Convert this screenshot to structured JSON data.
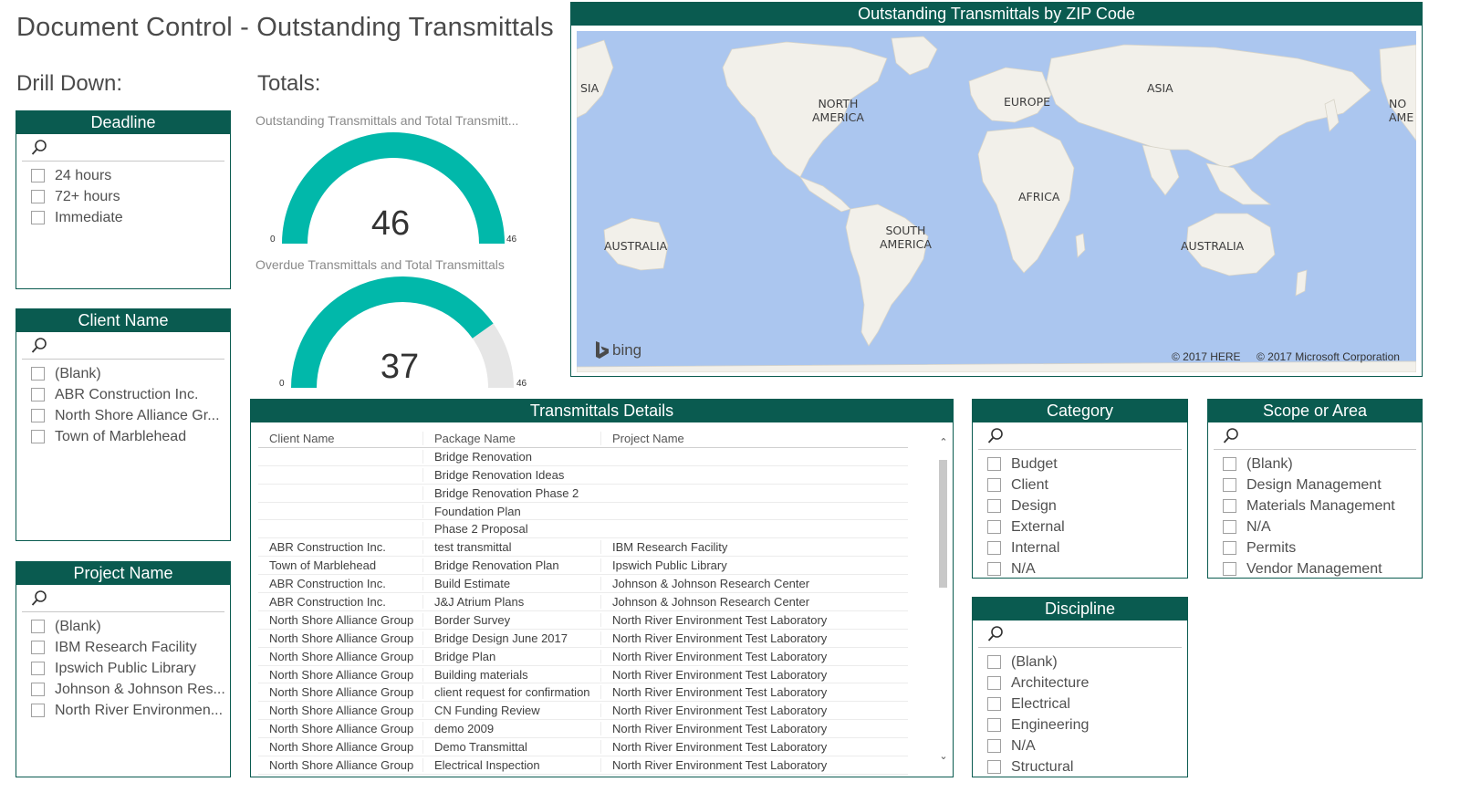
{
  "page_title": "Document Control - Outstanding Transmittals",
  "drill_down_label": "Drill Down:",
  "totals_label": "Totals:",
  "deadline": {
    "title": "Deadline",
    "items": [
      "24 hours",
      "72+ hours",
      "Immediate"
    ]
  },
  "client_name": {
    "title": "Client Name",
    "items": [
      "(Blank)",
      "ABR Construction Inc.",
      "North Shore Alliance Gr...",
      "Town of Marblehead"
    ]
  },
  "project_name": {
    "title": "Project Name",
    "items": [
      "(Blank)",
      "IBM Research Facility",
      "Ipswich Public Library",
      "Johnson & Johnson Res...",
      "North River Environmen..."
    ]
  },
  "gauges": [
    {
      "title": "Outstanding Transmittals and Total Transmitt...",
      "value": 46,
      "min": "0",
      "max": "46",
      "value_text": "46",
      "fraction": 1.0
    },
    {
      "title": "Overdue Transmittals and Total Transmittals",
      "value": 37,
      "min": "0",
      "max": "46",
      "value_text": "37",
      "fraction": 0.804
    }
  ],
  "map": {
    "title": "Outstanding Transmittals by ZIP Code",
    "labels": [
      "SIA",
      "NORTH\nAMERICA",
      "EUROPE",
      "ASIA",
      "NO\nAME",
      "AFRICA",
      "SOUTH\nAMERICA",
      "AUSTRALIA",
      "AUSTRALIA"
    ],
    "bing": "bing",
    "copyright_here": "© 2017 HERE",
    "copyright_ms": "© 2017 Microsoft Corporation"
  },
  "table": {
    "title": "Transmittals Details",
    "columns": [
      "Client Name",
      "Package Name",
      "Project Name"
    ],
    "rows": [
      [
        "",
        "Bridge Renovation",
        ""
      ],
      [
        "",
        "Bridge Renovation Ideas",
        ""
      ],
      [
        "",
        "Bridge Renovation Phase 2",
        ""
      ],
      [
        "",
        "Foundation Plan",
        ""
      ],
      [
        "",
        "Phase 2 Proposal",
        ""
      ],
      [
        "ABR Construction Inc.",
        "test transmittal",
        "IBM Research Facility"
      ],
      [
        "Town of Marblehead",
        "Bridge Renovation Plan",
        "Ipswich Public Library"
      ],
      [
        "ABR Construction Inc.",
        "Build Estimate",
        "Johnson & Johnson Research Center"
      ],
      [
        "ABR Construction Inc.",
        "J&J Atrium Plans",
        "Johnson & Johnson Research Center"
      ],
      [
        "North Shore Alliance Group",
        "Border Survey",
        "North River Environment Test Laboratory"
      ],
      [
        "North Shore Alliance Group",
        "Bridge Design June 2017",
        "North River Environment Test Laboratory"
      ],
      [
        "North Shore Alliance Group",
        "Bridge Plan",
        "North River Environment Test Laboratory"
      ],
      [
        "North Shore Alliance Group",
        "Building materials",
        "North River Environment Test Laboratory"
      ],
      [
        "North Shore Alliance Group",
        "client request for confirmation",
        "North River Environment Test Laboratory"
      ],
      [
        "North Shore Alliance Group",
        "CN Funding Review",
        "North River Environment Test Laboratory"
      ],
      [
        "North Shore Alliance Group",
        "demo 2009",
        "North River Environment Test Laboratory"
      ],
      [
        "North Shore Alliance Group",
        "Demo Transmittal",
        "North River Environment Test Laboratory"
      ],
      [
        "North Shore Alliance Group",
        "Electrical Inspection",
        "North River Environment Test Laboratory"
      ]
    ]
  },
  "category": {
    "title": "Category",
    "items": [
      "Budget",
      "Client",
      "Design",
      "External",
      "Internal",
      "N/A"
    ]
  },
  "scope": {
    "title": "Scope or Area",
    "items": [
      "(Blank)",
      "Design Management",
      "Materials Management",
      "N/A",
      "Permits",
      "Vendor Management"
    ]
  },
  "discipline": {
    "title": "Discipline",
    "items": [
      "(Blank)",
      "Architecture",
      "Electrical",
      "Engineering",
      "N/A",
      "Structural"
    ]
  },
  "colors": {
    "header": "#0a5b50",
    "gauge_fill": "#01b8aa",
    "gauge_track": "#e6e6e6",
    "map_water": "#abc6ef",
    "map_land": "#f2f0ea"
  }
}
